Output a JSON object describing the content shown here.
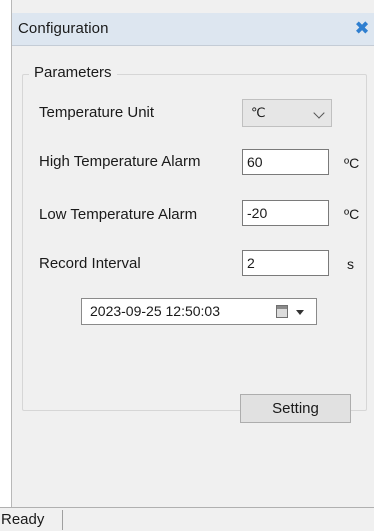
{
  "window": {
    "title": "Configuration",
    "close_glyph": "✖"
  },
  "parameters": {
    "group_label": "Parameters",
    "temperature_unit": {
      "label": "Temperature Unit",
      "selected": "℃"
    },
    "high_alarm": {
      "label": "High Temperature Alarm",
      "value": "60",
      "unit": "ºC"
    },
    "low_alarm": {
      "label": "Low Temperature Alarm",
      "value": "-20",
      "unit": "ºC"
    },
    "record_interval": {
      "label": "Record Interval",
      "value": "2",
      "unit": "s"
    },
    "datetime": {
      "value": "2023-09-25 12:50:03",
      "icon": "calendar-icon"
    }
  },
  "actions": {
    "setting_label": "Setting"
  },
  "statusbar": {
    "status": "Ready"
  },
  "colors": {
    "titlebar_bg": "#dde6f0",
    "close_icon": "#2f7fd0",
    "panel_bg": "#f0f0f0"
  }
}
